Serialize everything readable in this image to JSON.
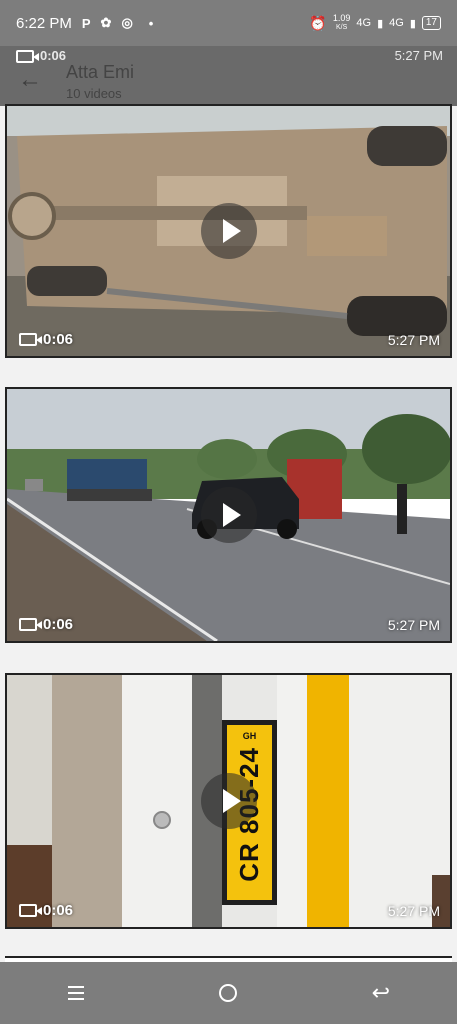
{
  "status_bar": {
    "time": "6:22 PM",
    "left_icons": [
      "p-icon",
      "pinwheel-icon",
      "whatsapp-icon",
      "dot-icon"
    ],
    "speed": "1.09",
    "speed_unit": "K/S",
    "network1": "4G",
    "network2": "4G",
    "battery": "17"
  },
  "header": {
    "back_icon": "arrow-left-icon",
    "title": "Atta Emi",
    "subtitle": "10 videos"
  },
  "ghost_video": {
    "duration": "0:06",
    "time": "5:27 PM"
  },
  "videos": [
    {
      "duration": "0:06",
      "time": "5:27 PM"
    },
    {
      "duration": "0:06",
      "time": "5:27 PM"
    },
    {
      "duration": "0:06",
      "time": "5:27 PM",
      "plate_text": "CR 805-24",
      "plate_suffix": "GH"
    }
  ],
  "nav": {
    "recents_icon": "recents-icon",
    "home_icon": "home-icon",
    "back_icon": "back-nav-icon"
  }
}
